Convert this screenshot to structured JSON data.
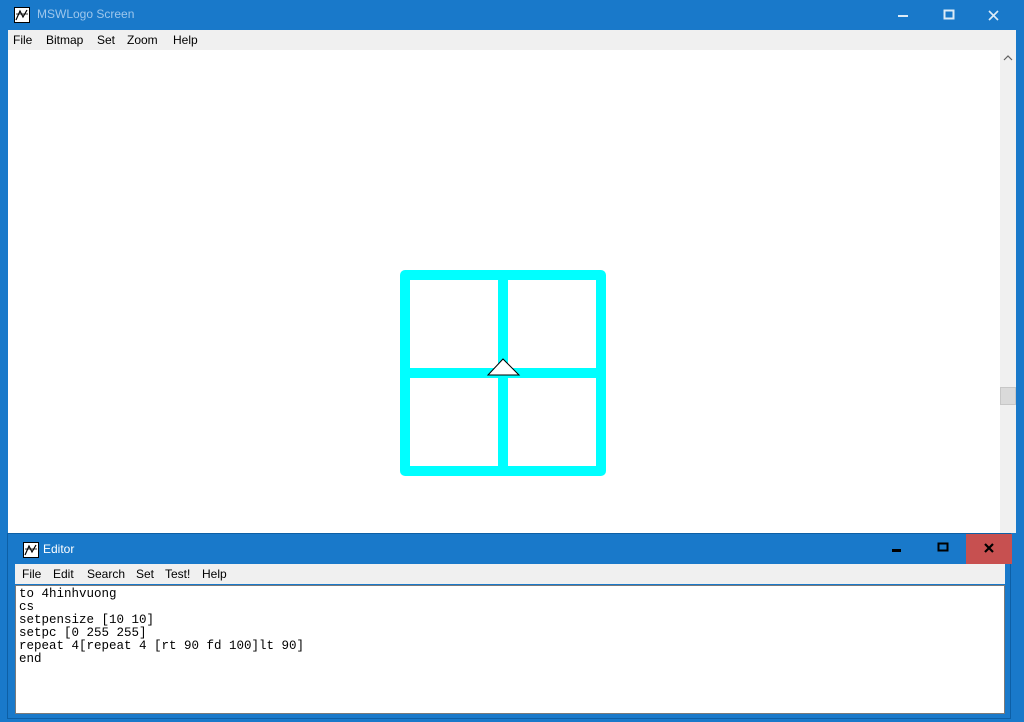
{
  "main_window": {
    "title": "MSWLogo Screen",
    "menu": [
      "File",
      "Bitmap",
      "Set",
      "Zoom",
      "Help"
    ],
    "controls": {
      "minimize_icon": "minimize-icon",
      "maximize_icon": "maximize-icon",
      "close_icon": "close-icon"
    }
  },
  "canvas": {
    "drawing": "grid-of-four-squares",
    "pen_color": "#00ffff",
    "turtle_icon": "turtle-triangle-icon"
  },
  "editor": {
    "title": "Editor",
    "menu": [
      "File",
      "Edit",
      "Search",
      "Set",
      "Test!",
      "Help"
    ],
    "code_lines": [
      "to 4hinhvuong",
      "cs",
      "setpensize [10 10]",
      "setpc [0 255 255]",
      "repeat 4[repeat 4 [rt 90 fd 100]lt 90]",
      "end"
    ]
  },
  "colors": {
    "titlebar": "#1979ca",
    "close_button": "#c75050",
    "menubar": "#f0f0f0"
  }
}
